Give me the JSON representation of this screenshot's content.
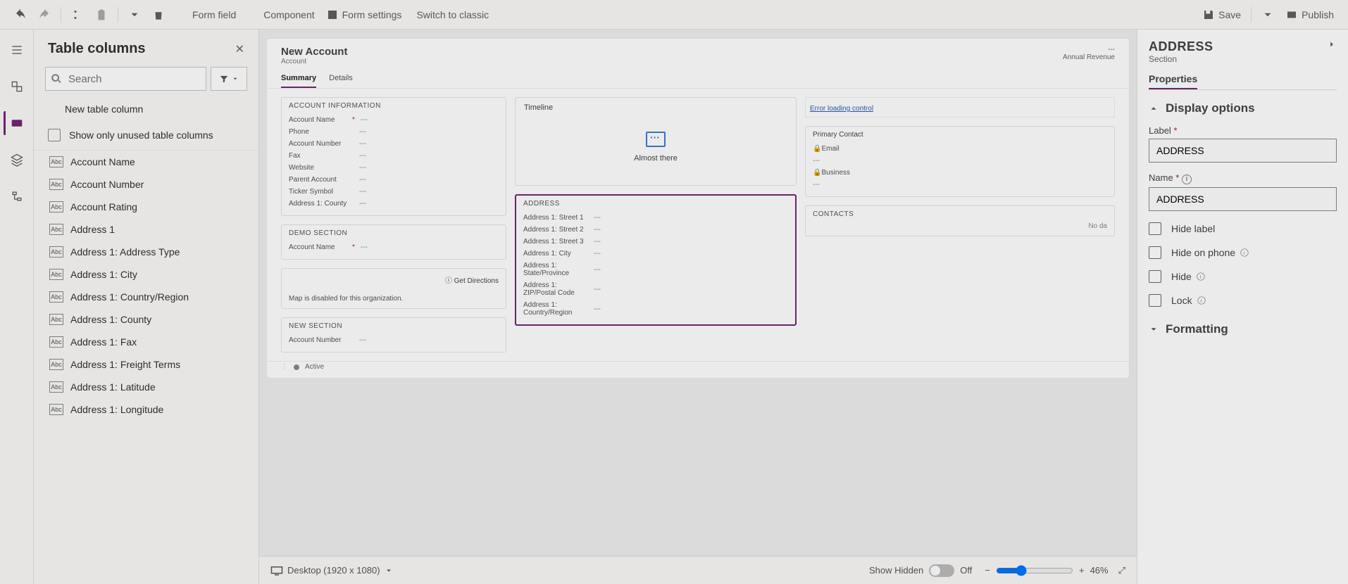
{
  "toolbar": {
    "form_field": "Form field",
    "component": "Component",
    "form_settings": "Form settings",
    "switch_classic": "Switch to classic",
    "save": "Save",
    "publish": "Publish"
  },
  "side_panel": {
    "title": "Table columns",
    "search_placeholder": "Search",
    "new_col": "New table column",
    "show_unused": "Show only unused table columns",
    "columns": [
      "Account Name",
      "Account Number",
      "Account Rating",
      "Address 1",
      "Address 1: Address Type",
      "Address 1: City",
      "Address 1: Country/Region",
      "Address 1: County",
      "Address 1: Fax",
      "Address 1: Freight Terms",
      "Address 1: Latitude",
      "Address 1: Longitude"
    ]
  },
  "canvas": {
    "form_title": "New Account",
    "form_subtitle": "Account",
    "hd_right1": "---",
    "hd_right2": "Annual Revenue",
    "tabs": [
      "Summary",
      "Details"
    ],
    "sections": {
      "acct_info": {
        "title": "ACCOUNT INFORMATION",
        "fields": [
          {
            "lbl": "Account Name",
            "req": true,
            "val": "---"
          },
          {
            "lbl": "Phone",
            "req": false,
            "val": "---"
          },
          {
            "lbl": "Account Number",
            "req": false,
            "val": "---"
          },
          {
            "lbl": "Fax",
            "req": false,
            "val": "---"
          },
          {
            "lbl": "Website",
            "req": false,
            "val": "---"
          },
          {
            "lbl": "Parent Account",
            "req": false,
            "val": "---"
          },
          {
            "lbl": "Ticker Symbol",
            "req": false,
            "val": "---"
          },
          {
            "lbl": "Address 1: County",
            "req": false,
            "val": "---"
          }
        ]
      },
      "demo": {
        "title": "Demo Section",
        "fields": [
          {
            "lbl": "Account Name",
            "req": true,
            "val": "---"
          }
        ]
      },
      "map": {
        "text": "Map is disabled for this organization.",
        "get_dir": "Get Directions"
      },
      "new_sec": {
        "title": "New Section",
        "fields": [
          {
            "lbl": "Account Number",
            "req": false,
            "val": "---"
          }
        ]
      },
      "timeline": {
        "title": "Timeline",
        "status": "Almost there"
      },
      "address": {
        "title": "ADDRESS",
        "fields": [
          {
            "lbl": "Address 1: Street 1",
            "val": "---"
          },
          {
            "lbl": "Address 1: Street 2",
            "val": "---"
          },
          {
            "lbl": "Address 1: Street 3",
            "val": "---"
          },
          {
            "lbl": "Address 1: City",
            "val": "---"
          },
          {
            "lbl": "Address 1: State/Province",
            "val": "---"
          },
          {
            "lbl": "Address 1: ZIP/Postal Code",
            "val": "---"
          },
          {
            "lbl": "Address 1: Country/Region",
            "val": "---"
          }
        ]
      },
      "right": {
        "error": "Error loading control",
        "primary": "Primary Contact",
        "email": "Email",
        "email_val": "---",
        "business": "Business",
        "business_val": "---",
        "contacts": "CONTACTS",
        "nodata": "No da"
      }
    },
    "status_text": "Active"
  },
  "canvas_footer": {
    "device": "Desktop (1920 x 1080)",
    "show_hidden": "Show Hidden",
    "off": "Off",
    "zoom": "46%"
  },
  "prop": {
    "title": "ADDRESS",
    "sub": "Section",
    "tab": "Properties",
    "group_display": "Display options",
    "label_lbl": "Label",
    "label_val": "ADDRESS",
    "name_lbl": "Name",
    "name_val": "ADDRESS",
    "hide_label": "Hide label",
    "hide_phone": "Hide on phone",
    "hide": "Hide",
    "lock": "Lock",
    "group_fmt": "Formatting"
  }
}
